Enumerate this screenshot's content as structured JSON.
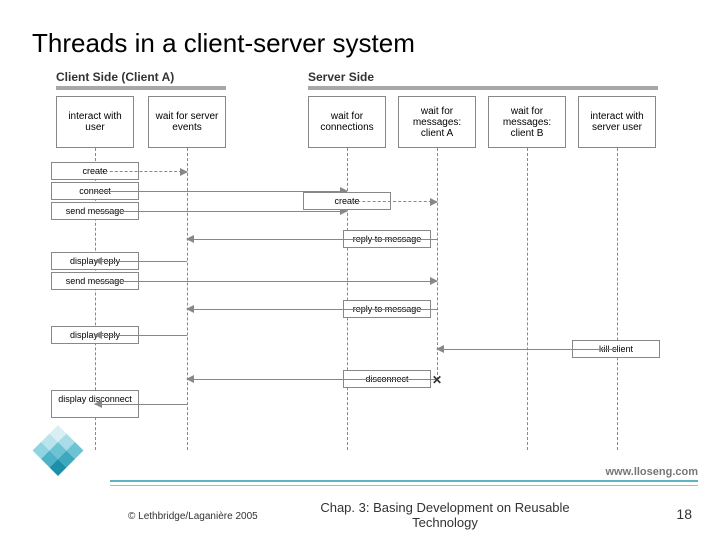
{
  "title": "Threads in a client-server system",
  "sides": {
    "client": "Client Side (Client A)",
    "server": "Server Side"
  },
  "lanes": {
    "c1": "interact with user",
    "c2": "wait for server events",
    "s1": "wait for connections",
    "s2": "wait for messages: client A",
    "s3": "wait for messages: client B",
    "s4": "interact with server user"
  },
  "messages": {
    "create1": "create",
    "connect": "connect",
    "send1": "send message",
    "create2": "create",
    "reply1": "reply to message",
    "disp_reply1": "display reply",
    "send2": "send message",
    "reply2": "reply to message",
    "disp_reply2": "display reply",
    "kill": "kill client",
    "disconnect": "disconnect",
    "disp_disc": "display disconnect"
  },
  "footer": {
    "url": "www.lloseng.com",
    "copyright": "© Lethbridge/Laganière 2005",
    "chapter": "Chap. 3: Basing Development on Reusable Technology",
    "page": "18"
  },
  "chart_data": {
    "type": "sequence-diagram",
    "sides": [
      {
        "name": "Client Side (Client A)",
        "lanes": [
          "interact with user",
          "wait for server events"
        ]
      },
      {
        "name": "Server Side",
        "lanes": [
          "wait for connections",
          "wait for messages: client A",
          "wait for messages: client B",
          "interact with server user"
        ]
      }
    ],
    "lanes": [
      "c1",
      "c2",
      "s1",
      "s2",
      "s3",
      "s4"
    ],
    "messages": [
      {
        "from": "c1",
        "to": "c2",
        "label": "create",
        "style": "dashed"
      },
      {
        "from": "c1",
        "to": "s1",
        "label": "connect"
      },
      {
        "from": "c1",
        "to": "s1",
        "label": "send message"
      },
      {
        "from": "s1",
        "to": "s2",
        "label": "create",
        "style": "dashed"
      },
      {
        "from": "s2",
        "to": "c2",
        "label": "reply to message",
        "dir": "left"
      },
      {
        "from": "c2",
        "to": "c1",
        "label": "display reply",
        "dir": "left"
      },
      {
        "from": "c1",
        "to": "s2",
        "label": "send message"
      },
      {
        "from": "s2",
        "to": "c2",
        "label": "reply to message",
        "dir": "left"
      },
      {
        "from": "c2",
        "to": "c1",
        "label": "display reply",
        "dir": "left"
      },
      {
        "from": "s4",
        "to": "s2",
        "label": "kill client",
        "dir": "left"
      },
      {
        "from": "s2",
        "to": "c2",
        "label": "disconnect",
        "dir": "left",
        "terminates": "s2"
      },
      {
        "from": "c2",
        "to": "c1",
        "label": "display disconnect",
        "dir": "left"
      }
    ]
  }
}
